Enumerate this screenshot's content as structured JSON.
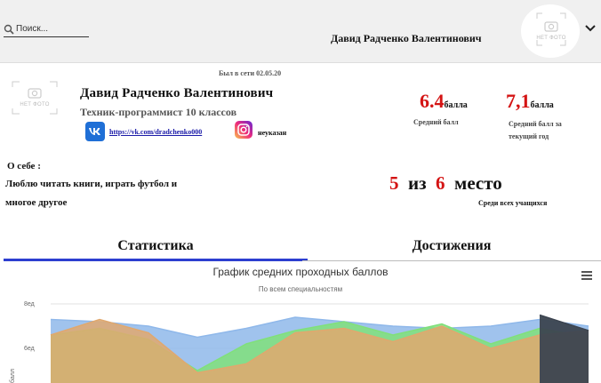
{
  "header": {
    "search_placeholder": "Поиск...",
    "user_name": "Давид Радченко Валентинович",
    "avatar_label": "НЕТ ФОТО"
  },
  "profile": {
    "last_seen": "Был в сети 02.05.20",
    "photo_label": "НЕТ ФОТО",
    "name": "Давид Радченко Валентинович",
    "role": "Техник-программист 10 классов",
    "vk_url": "https://vk.com/dradchenko000",
    "instagram": "неуказан"
  },
  "scores": {
    "average": {
      "value": "6.4",
      "unit": "балла",
      "caption": "Средний балл"
    },
    "current": {
      "value": "7,1",
      "unit": "балла",
      "caption": "Средний балл за текущий год"
    }
  },
  "about": {
    "title": "О себе :",
    "text": "Люблю читать книги, играть футбол и многое другое"
  },
  "rank": {
    "place": "5",
    "of_word": "из",
    "total": "6",
    "place_word": "место",
    "caption": "Среди всех учащихся"
  },
  "tabs": [
    {
      "label": "Статистика",
      "active": true
    },
    {
      "label": "Достижения",
      "active": false
    }
  ],
  "chart_data": {
    "type": "area",
    "title": "График средних проходных баллов",
    "subtitle": "По всем специальностям",
    "ylabel": "балл",
    "ylim": [
      4,
      8.5
    ],
    "yticks": [
      {
        "value": 8,
        "label": "8ед"
      },
      {
        "value": 6,
        "label": "6ед"
      }
    ],
    "x": [
      0,
      1,
      2,
      3,
      4,
      5,
      6,
      7,
      8,
      9,
      10,
      11
    ],
    "series": [
      {
        "color": "#8fb8ea",
        "values": [
          7.3,
          7.2,
          7.0,
          6.5,
          6.9,
          7.4,
          7.2,
          7.0,
          6.9,
          7.0,
          7.3,
          7.0
        ]
      },
      {
        "color": "#80e07a",
        "values": [
          6.6,
          6.9,
          6.4,
          5.0,
          6.2,
          6.8,
          7.2,
          6.6,
          7.1,
          6.2,
          6.9,
          6.5
        ]
      },
      {
        "color": "#e0a86e",
        "values": [
          6.6,
          7.3,
          6.7,
          4.9,
          5.3,
          6.7,
          6.9,
          6.3,
          7.0,
          6.0,
          6.6,
          6.8
        ]
      },
      {
        "color": "#3c4450",
        "values": [
          null,
          null,
          null,
          null,
          null,
          null,
          null,
          null,
          null,
          null,
          7.5,
          6.8
        ]
      }
    ]
  },
  "colors": {
    "accent_red": "#d41414",
    "tab_underline": "#2d3fd0",
    "vk_blue": "#1f6fd6"
  }
}
